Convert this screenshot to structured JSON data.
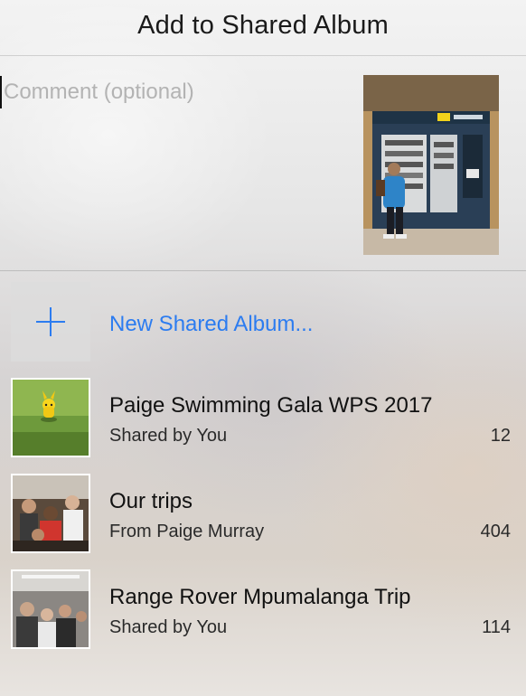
{
  "header": {
    "title": "Add to Shared Album"
  },
  "comment": {
    "placeholder": "Comment (optional)",
    "value": ""
  },
  "preview": {
    "icon": "photo-preview"
  },
  "new_album": {
    "label": "New Shared Album...",
    "icon": "plus-icon",
    "accent": "#2c7cf0"
  },
  "albums": [
    {
      "title": "Paige Swimming Gala WPS 2017",
      "subtitle": "Shared by You",
      "count": "12"
    },
    {
      "title": "Our trips",
      "subtitle": "From Paige Murray",
      "count": "404"
    },
    {
      "title": "Range Rover Mpumalanga Trip",
      "subtitle": "Shared by You",
      "count": "114"
    }
  ]
}
